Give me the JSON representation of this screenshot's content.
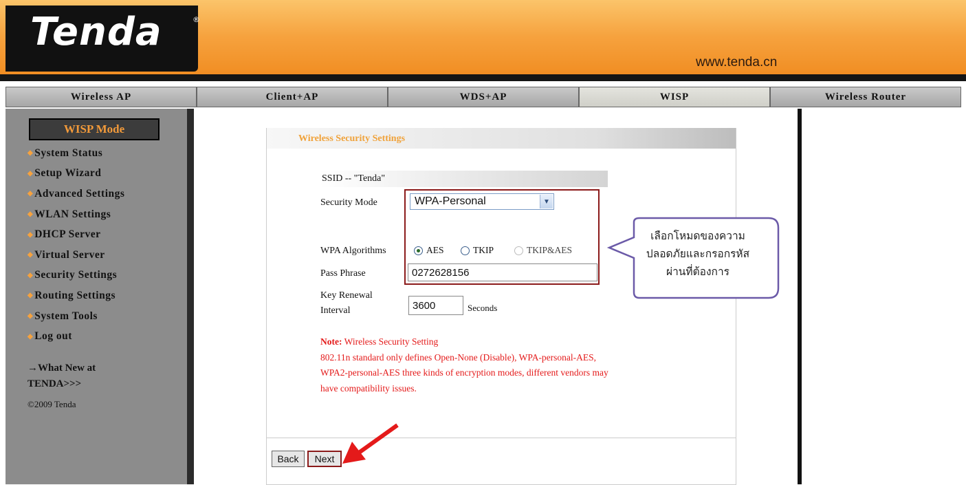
{
  "header": {
    "logo": "Tenda",
    "logo_mark": "®",
    "url": "www.tenda.cn"
  },
  "tabs": [
    {
      "label": "Wireless AP",
      "active": false
    },
    {
      "label": "Client+AP",
      "active": false
    },
    {
      "label": "WDS+AP",
      "active": false
    },
    {
      "label": "WISP",
      "active": true
    },
    {
      "label": "Wireless Router",
      "active": false
    }
  ],
  "sidebar": {
    "mode": "WISP Mode",
    "items": [
      "System Status",
      "Setup Wizard",
      "Advanced Settings",
      "WLAN Settings",
      "DHCP Server",
      "Virtual Server",
      "Security Settings",
      "Routing Settings",
      "System Tools",
      "Log out"
    ],
    "whatnew_line1": "→What New at",
    "whatnew_line2": "TENDA>>>",
    "copyright": "©2009 Tenda"
  },
  "panel": {
    "title": "Wireless Security Settings",
    "ssid": "SSID -- \"Tenda\"",
    "security_mode_label": "Security Mode",
    "security_mode_value": "WPA-Personal",
    "wpa_algorithms_label": "WPA Algorithms",
    "algorithms": [
      {
        "label": "AES",
        "selected": true,
        "enabled": true
      },
      {
        "label": "TKIP",
        "selected": false,
        "enabled": true
      },
      {
        "label": "TKIP&AES",
        "selected": false,
        "enabled": false
      }
    ],
    "pass_phrase_label": "Pass Phrase",
    "pass_phrase_value": "0272628156",
    "key_renewal_label_1": "Key Renewal",
    "key_renewal_label_2": "Interval",
    "key_renewal_value": "3600",
    "key_renewal_unit": "Seconds",
    "note_prefix": "Note:",
    "note_title": " Wireless Security Setting",
    "note_body": "802.11n standard only defines Open-None (Disable), WPA-personal-AES, WPA2-personal-AES three kinds of encryption modes, different vendors may have compatibility issues.",
    "back_label": "Back",
    "next_label": "Next"
  },
  "callout": {
    "line1": "เลือกโหมดของความ",
    "line2": "ปลอดภัยและกรอกรหัส",
    "line3": "ผ่านที่ต้องการ"
  },
  "colors": {
    "header_orange": "#f6a23e",
    "highlight_red": "#8b1a1a",
    "note_red": "#e41a1a",
    "callout_border": "#6b5aa8"
  }
}
